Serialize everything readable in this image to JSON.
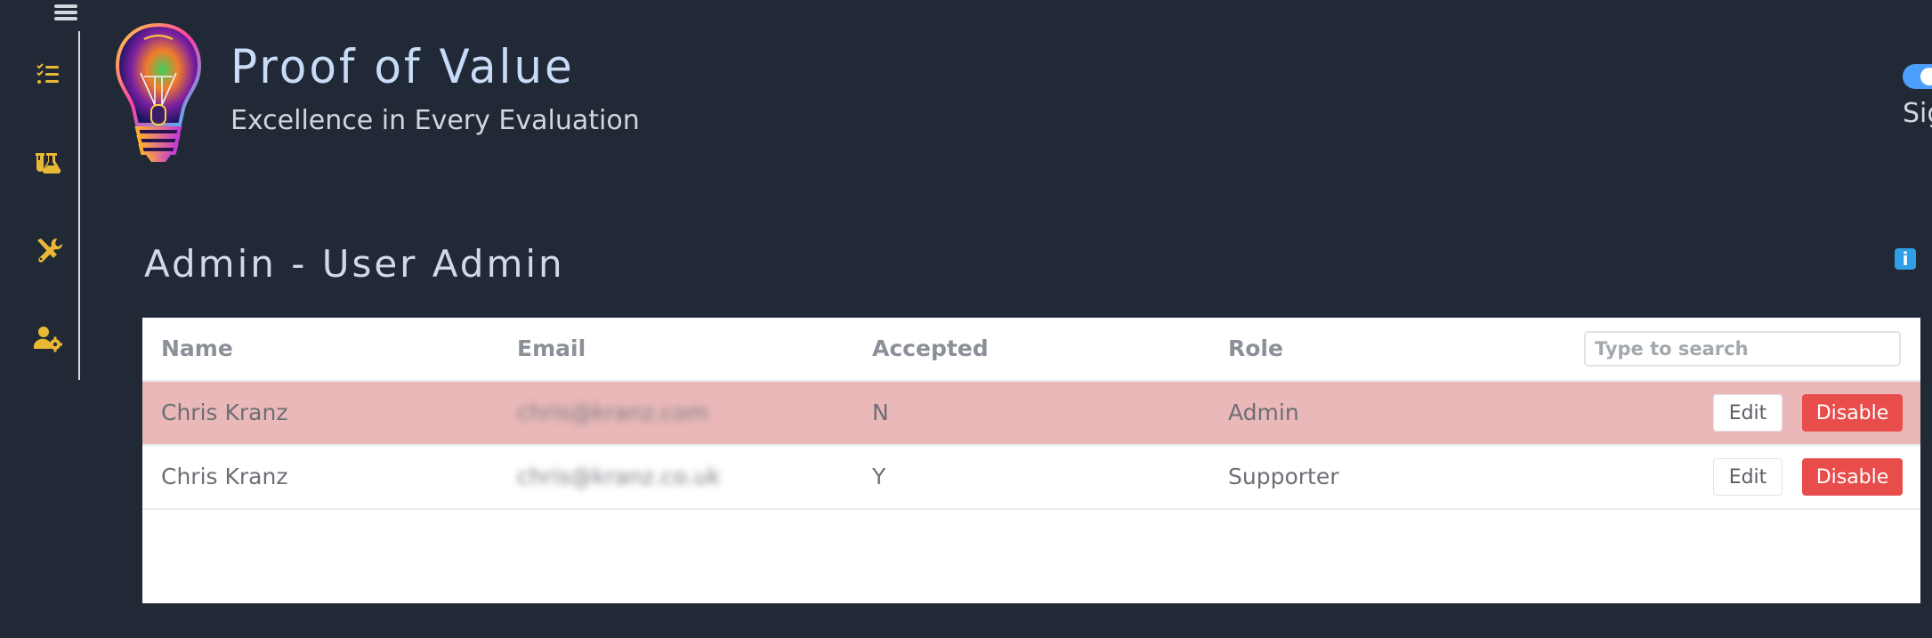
{
  "header": {
    "app_title": "Proof of Value",
    "app_subtitle": "Excellence in Every Evaluation",
    "sign_link": "Sign",
    "toggle_on": true
  },
  "sidebar": {
    "items": [
      {
        "icon": "checklist-icon",
        "label": "Checklist"
      },
      {
        "icon": "flask-icon",
        "label": "Lab"
      },
      {
        "icon": "tools-icon",
        "label": "Tools"
      },
      {
        "icon": "user-gear-icon",
        "label": "User Admin"
      }
    ]
  },
  "page": {
    "title": "Admin - User Admin",
    "info_icon": "i"
  },
  "table": {
    "columns": [
      "Name",
      "Email",
      "Accepted",
      "Role"
    ],
    "search_placeholder": "Type to search",
    "search_value": "",
    "rows": [
      {
        "name": "Chris Kranz",
        "email": "chris@kranz.com",
        "accepted": "N",
        "role": "Admin",
        "highlighted": true,
        "edit_label": "Edit",
        "disable_label": "Disable"
      },
      {
        "name": "Chris Kranz",
        "email": "chris@kranz.co.uk",
        "accepted": "Y",
        "role": "Supporter",
        "highlighted": false,
        "edit_label": "Edit",
        "disable_label": "Disable"
      }
    ]
  },
  "colors": {
    "background": "#212936",
    "accent_icon": "#e9b935",
    "highlight_row": "#eab8b8",
    "danger": "#e84d4b",
    "toggle": "#4c9ffb",
    "info": "#2f9fe6"
  }
}
